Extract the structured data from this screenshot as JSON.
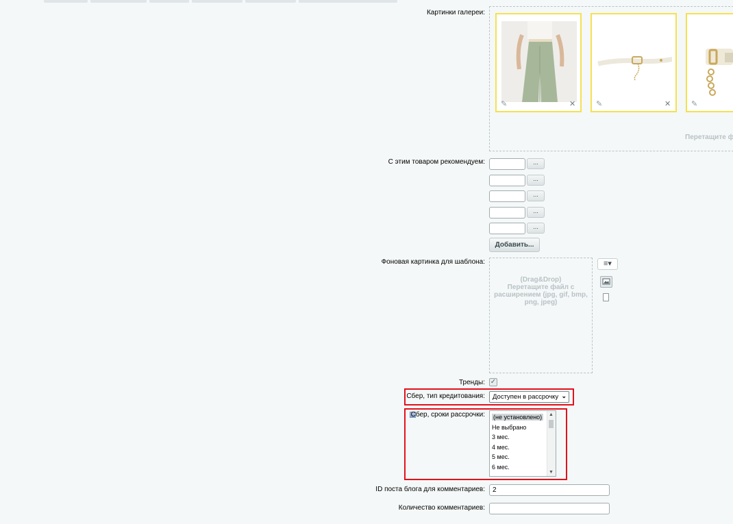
{
  "gallery": {
    "label": "Картинки галереи:",
    "drop_hint": "Перетащите ф"
  },
  "recommend": {
    "label": "С этим товаром рекомендуем:",
    "rows": [
      "",
      "",
      "",
      "",
      ""
    ],
    "dots_label": "...",
    "add_button": "Добавить..."
  },
  "background": {
    "label": "Фоновая картинка для шаблона:",
    "hint_line1": "(Drag&Drop)",
    "hint_line2": "Перетащите файл с",
    "hint_line3": "расширением (jpg, gif, bmp,",
    "hint_line4": "png, jpeg)"
  },
  "trends": {
    "label": "Тренды:",
    "checked": true
  },
  "credit_type": {
    "label": "Сбер, тип кредитования:",
    "selected": "Доступен в рассрочку"
  },
  "installment_terms": {
    "label": "Сбер, сроки рассрочки:",
    "options": [
      "(не установлено)",
      "Не выбрано",
      "3 мес.",
      "4 мес.",
      "5 мес.",
      "6 мес."
    ]
  },
  "blog_post": {
    "label": "ID поста блога для комментариев:",
    "value": "2"
  },
  "comment_count": {
    "label": "Количество комментариев:",
    "value": ""
  },
  "colors": {
    "highlight": "#e3101a",
    "thumb_border": "#f5e050"
  }
}
